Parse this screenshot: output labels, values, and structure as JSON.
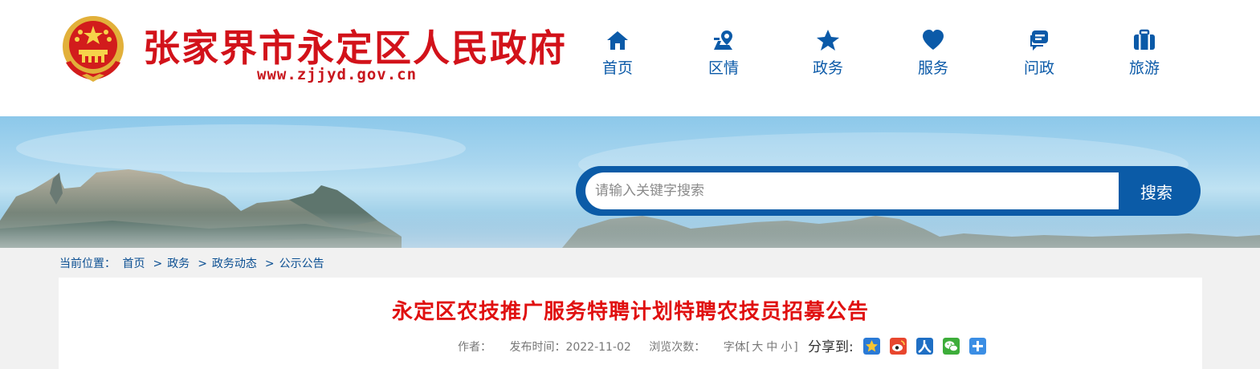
{
  "header": {
    "site_title": "张家界市永定区人民政府",
    "site_url": "www.zjjyd.gov.cn",
    "brand_color": "#d2121a"
  },
  "nav": {
    "items": [
      {
        "label": "首页",
        "icon": "home-icon"
      },
      {
        "label": "区情",
        "icon": "map-pin-icon"
      },
      {
        "label": "政务",
        "icon": "star-icon"
      },
      {
        "label": "服务",
        "icon": "heart-icon"
      },
      {
        "label": "问政",
        "icon": "chat-icon"
      },
      {
        "label": "旅游",
        "icon": "suitcase-icon"
      }
    ],
    "color": "#0b5aa8"
  },
  "search": {
    "placeholder": "请输入关键字搜索",
    "button_label": "搜索"
  },
  "breadcrumb": {
    "prefix": "当前位置：",
    "items": [
      "首页",
      "政务",
      "政务动态",
      "公示公告"
    ],
    "separator": ">"
  },
  "article": {
    "title": "永定区农技推广服务特聘计划特聘农技员招募公告",
    "author_label": "作者：",
    "published_label": "发布时间：",
    "published_date": "2022-11-02",
    "views_label": "浏览次数：",
    "font_label": "字体[",
    "font_large": "大",
    "font_medium": "中",
    "font_small": "小",
    "font_close": "]",
    "share_label": "分享到:",
    "share_icons": [
      "qzone-icon",
      "weibo-icon",
      "renren-icon",
      "wechat-icon",
      "more-share-icon"
    ],
    "title_color": "#e01010"
  }
}
